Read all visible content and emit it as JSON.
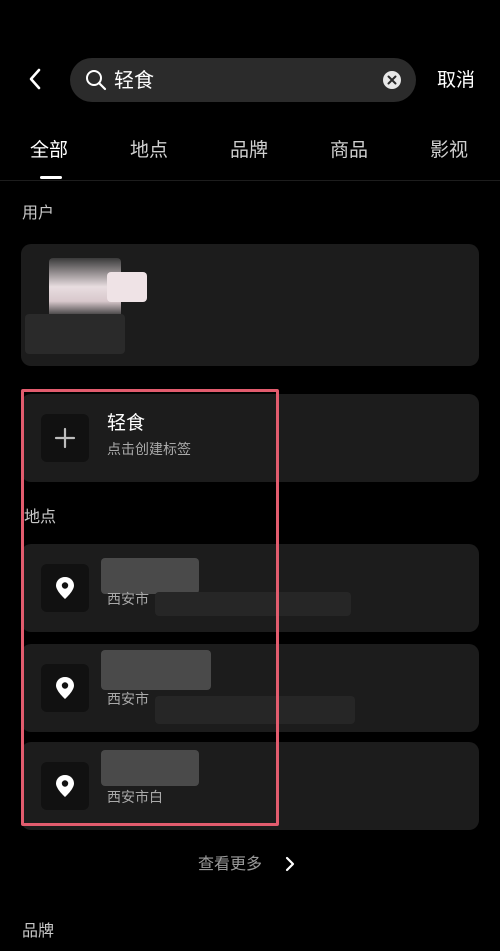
{
  "search": {
    "query": "轻食",
    "cancel_label": "取消"
  },
  "tabs": [
    {
      "label": "全部",
      "active": true
    },
    {
      "label": "地点",
      "active": false
    },
    {
      "label": "品牌",
      "active": false
    },
    {
      "label": "商品",
      "active": false
    },
    {
      "label": "影视",
      "active": false
    }
  ],
  "sections": {
    "users_label": "用户",
    "places_label": "地点",
    "brands_label": "品牌"
  },
  "create_tag": {
    "title": "轻食",
    "subtitle": "点击创建标签"
  },
  "places": [
    {
      "name": "",
      "address": "西安市"
    },
    {
      "name": "",
      "address": "西安市"
    },
    {
      "name": "",
      "address": "西安市白"
    }
  ],
  "show_more_label": "查看更多",
  "colors": {
    "background": "#000000",
    "card": "#1c1c1c",
    "search_bg": "#2b2b2b",
    "highlight_box": "#e25c6e"
  },
  "icons": [
    "back-arrow-icon",
    "search-icon",
    "clear-icon",
    "plus-icon",
    "location-pin-icon",
    "chevron-right-icon"
  ]
}
